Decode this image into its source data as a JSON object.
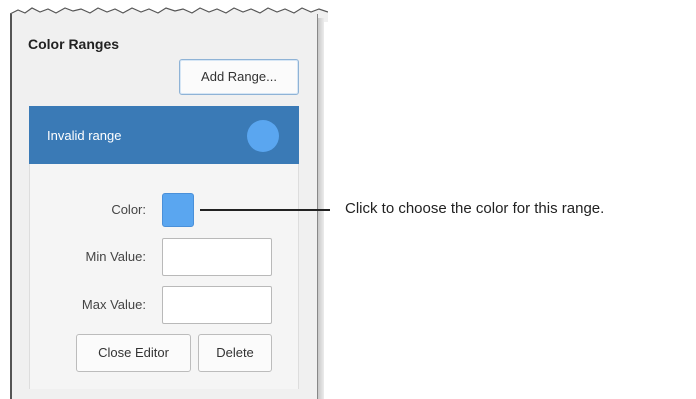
{
  "panel": {
    "section_title": "Color Ranges",
    "add_range_label": "Add Range...",
    "range": {
      "name": "Invalid range",
      "color": "#5aa6f0",
      "header_color": "#3a7ab6"
    },
    "editor": {
      "color_label": "Color:",
      "min_label": "Min Value:",
      "max_label": "Max Value:",
      "min_value": "",
      "max_value": "",
      "close_label": "Close Editor",
      "delete_label": "Delete"
    }
  },
  "callout": {
    "text": "Click to choose the color for this range."
  }
}
